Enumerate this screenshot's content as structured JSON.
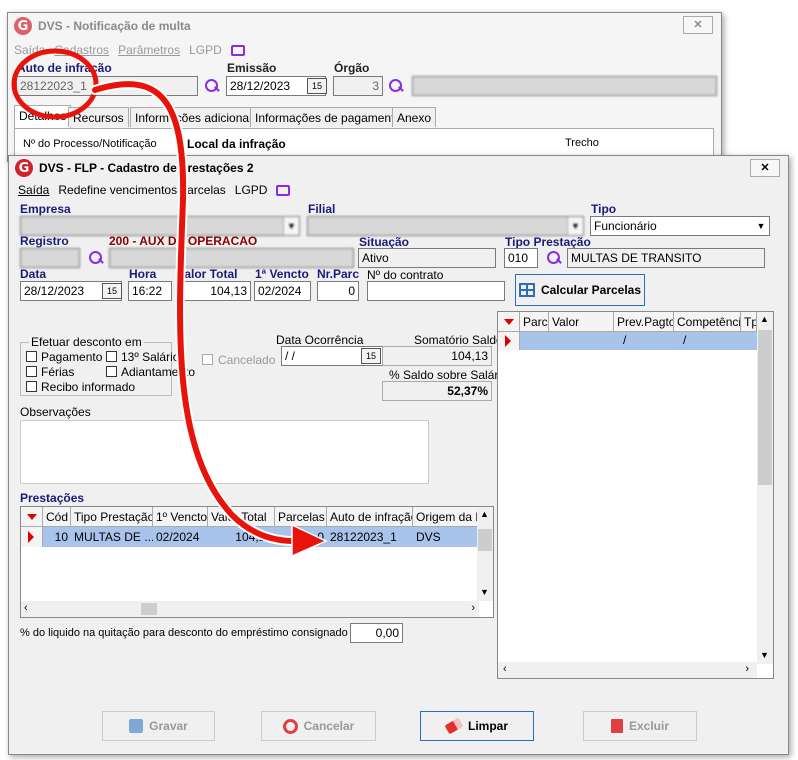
{
  "back_window": {
    "title": "DVS - Notificação de multa",
    "close_label": "✕",
    "menu": [
      "Saída",
      "Cadastros",
      "Parâmetros",
      "LGPD"
    ],
    "auto_label": "Auto de infração",
    "auto_value": "28122023_1",
    "emissao_label": "Emissão",
    "emissao_value": "28/12/2023",
    "orgao_label": "Órgão",
    "orgao_value": "3",
    "tabs": [
      "Detalhes",
      "Recursos",
      "Informações adicionais",
      "Informações de pagamento",
      "Anexo"
    ],
    "processo_label": "Nº do Processo/Notificação",
    "local_label": "Local da infração",
    "trecho_label": "Trecho"
  },
  "front_window": {
    "title": "DVS - FLP - Cadastro de prestações 2",
    "close_label": "✕",
    "menu": [
      "Saída",
      "Redefine vencimentos parcelas",
      "LGPD"
    ],
    "empresa_label": "Empresa",
    "filial_label": "Filial",
    "tipo_label": "Tipo",
    "tipo_value": "Funcionário",
    "registro_label": "Registro",
    "cargo_value": "200 - AUX DE OPERACAO",
    "situacao_label": "Situação",
    "situacao_value": "Ativo",
    "tipo_prestacao_label": "Tipo Prestação",
    "tipo_prestacao_code": "010",
    "tipo_prestacao_value": "MULTAS DE TRANSITO",
    "data_label": "Data",
    "data_value": "28/12/2023",
    "hora_label": "Hora",
    "hora_value": "16:22",
    "valor_total_label": "Valor Total",
    "valor_total_value": "104,13",
    "primeiro_vencto_label": "1ª Vencto",
    "primeiro_vencto_value": "02/2024",
    "nr_parc_label": "Nr.Parc",
    "nr_parc_value": "0",
    "contrato_label": "Nº do contrato",
    "calcular_label": "Calcular Parcelas",
    "desconto_group_label": "Efetuar desconto em",
    "check_pagamento": "Pagamento",
    "check_13": "13º Salário",
    "check_ferias": "Férias",
    "check_adiantamento": "Adiantamento",
    "check_recibo": "Recibo informado",
    "cancelado_label": "Cancelado",
    "data_ocorrencia_label": "Data Ocorrência",
    "data_ocorrencia_value": " /  /",
    "somatorio_label": "Somatório Saldo",
    "somatorio_value": "104,13",
    "pct_saldo_label": "% Saldo sobre Salário",
    "pct_saldo_value": "52,37%",
    "observacoes_label": "Observações",
    "prestacoes_label": "Prestações",
    "prestacoes_columns": [
      "Cód",
      "Tipo Prestação",
      "1º Vencto",
      "Valor Total",
      "Parcelas",
      "Auto de infração",
      "Origem da Pr"
    ],
    "prestacoes_rows": [
      {
        "cod": "10",
        "tipo": "MULTAS DE ...",
        "vencto": "02/2024",
        "valor": "104,13",
        "parcelas": "0",
        "auto": "28122023_1",
        "origem": "DVS"
      }
    ],
    "parcelas_columns": [
      "Parc",
      "Valor",
      "Prev.Pagto",
      "Competência",
      "Tp"
    ],
    "parcelas_row": {
      "prev": "/",
      "comp": "/"
    },
    "pct_liquido_label": "% do liquido na quitação para desconto do empréstimo consignado",
    "pct_liquido_value": "0,00",
    "gravar_label": "Gravar",
    "cancelar_label": "Cancelar",
    "limpar_label": "Limpar",
    "excluir_label": "Excluir"
  },
  "colors": {
    "accent_red": "#e8140c",
    "label_blue": "#1a1a7a",
    "cargo_red": "#8b0000",
    "selected_row": "#a9c4ea",
    "icon_purple": "#8a2be2"
  }
}
